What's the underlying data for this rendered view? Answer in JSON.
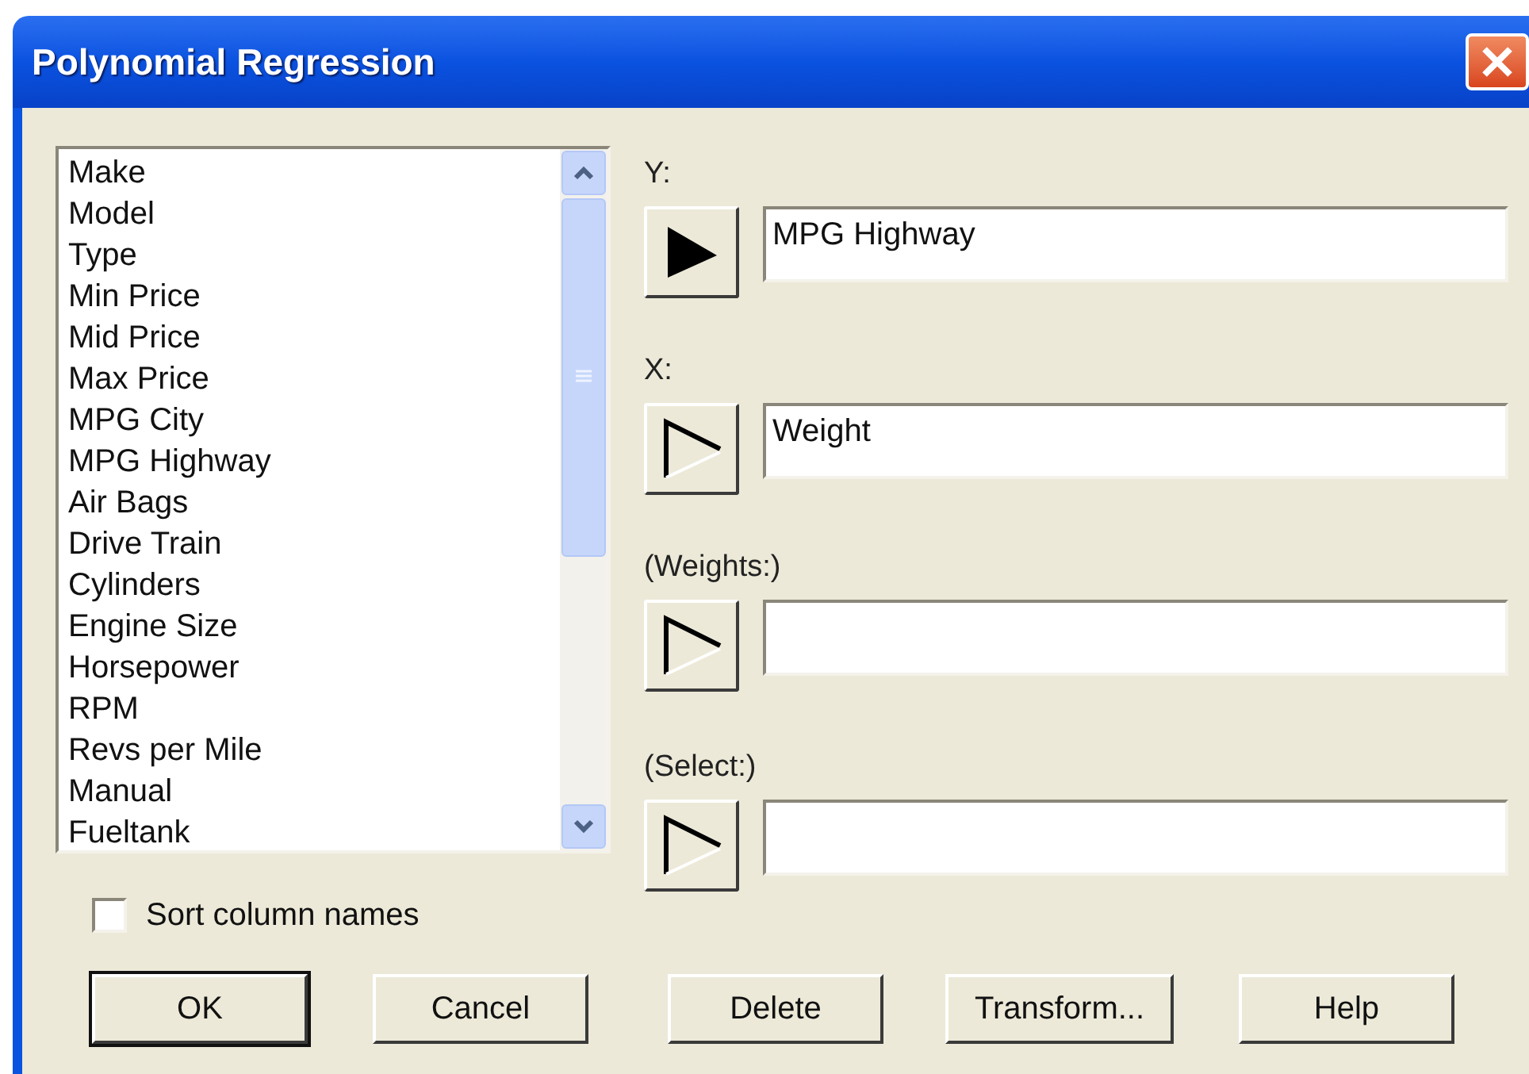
{
  "window": {
    "title": "Polynomial Regression"
  },
  "columns": [
    "Make",
    "Model",
    "Type",
    "Min Price",
    "Mid Price",
    "Max Price",
    "MPG City",
    "MPG Highway",
    "Air Bags",
    "Drive Train",
    "Cylinders",
    "Engine Size",
    "Horsepower",
    "RPM",
    "Revs per Mile",
    "Manual",
    "Fueltank"
  ],
  "sort_column_names": {
    "label": "Sort column names",
    "checked": false
  },
  "variables": [
    {
      "label": "Y:",
      "value": "MPG Highway",
      "active": true
    },
    {
      "label": "X:",
      "value": "Weight",
      "active": false
    },
    {
      "label": "(Weights:)",
      "active": false
    },
    {
      "label": "(Select:)",
      "active": false
    }
  ],
  "buttons": [
    {
      "label": "OK",
      "default": true
    },
    {
      "label": "Cancel",
      "default": false
    },
    {
      "label": "Delete",
      "default": false
    },
    {
      "label": "Transform...",
      "default": false
    },
    {
      "label": "Help",
      "default": false
    }
  ]
}
